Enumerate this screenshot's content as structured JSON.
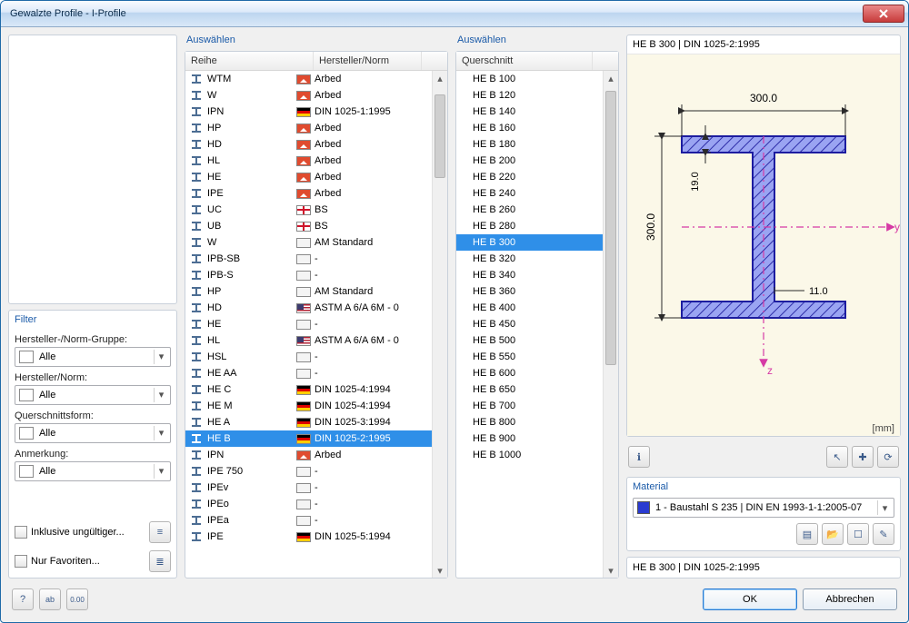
{
  "window": {
    "title": "Gewalzte Profile - I-Profile"
  },
  "filter": {
    "title": "Filter",
    "group_label": "Hersteller-/Norm-Gruppe:",
    "norm_label": "Hersteller/Norm:",
    "shape_label": "Querschnittsform:",
    "note_label": "Anmerkung:",
    "all": "Alle",
    "invalid": "Inklusive ungültiger...",
    "fav": "Nur Favoriten..."
  },
  "select_label": "Auswählen",
  "series_headers": {
    "c1": "Reihe",
    "c2": "Hersteller/Norm"
  },
  "series_scroll": {
    "thumb_top": 10,
    "thumb_height": 90
  },
  "series": [
    {
      "name": "IPE",
      "flag": "de",
      "norm": "DIN 1025-5:1994"
    },
    {
      "name": "IPEa",
      "flag": "blank",
      "norm": "-"
    },
    {
      "name": "IPEo",
      "flag": "blank",
      "norm": "-"
    },
    {
      "name": "IPEv",
      "flag": "blank",
      "norm": "-"
    },
    {
      "name": "IPE 750",
      "flag": "blank",
      "norm": "-"
    },
    {
      "name": "IPN",
      "flag": "red",
      "norm": "Arbed"
    },
    {
      "name": "HE B",
      "flag": "de",
      "norm": "DIN 1025-2:1995",
      "selected": true
    },
    {
      "name": "HE A",
      "flag": "de",
      "norm": "DIN 1025-3:1994"
    },
    {
      "name": "HE M",
      "flag": "de",
      "norm": "DIN 1025-4:1994"
    },
    {
      "name": "HE C",
      "flag": "de",
      "norm": "DIN 1025-4:1994"
    },
    {
      "name": "HE AA",
      "flag": "blank",
      "norm": "-"
    },
    {
      "name": "HSL",
      "flag": "blank",
      "norm": "-"
    },
    {
      "name": "HL",
      "flag": "us",
      "norm": "ASTM A 6/A 6M - 0"
    },
    {
      "name": "HE",
      "flag": "blank",
      "norm": "-"
    },
    {
      "name": "HD",
      "flag": "us",
      "norm": "ASTM A 6/A 6M - 0"
    },
    {
      "name": "HP",
      "flag": "blank",
      "norm": "AM Standard"
    },
    {
      "name": "IPB-S",
      "flag": "blank",
      "norm": "-"
    },
    {
      "name": "IPB-SB",
      "flag": "blank",
      "norm": "-"
    },
    {
      "name": "W",
      "flag": "blank",
      "norm": "AM Standard"
    },
    {
      "name": "UB",
      "flag": "uk",
      "norm": "BS"
    },
    {
      "name": "UC",
      "flag": "uk",
      "norm": "BS"
    },
    {
      "name": "IPE",
      "flag": "red",
      "norm": "Arbed"
    },
    {
      "name": "HE",
      "flag": "red",
      "norm": "Arbed"
    },
    {
      "name": "HL",
      "flag": "red",
      "norm": "Arbed"
    },
    {
      "name": "HD",
      "flag": "red",
      "norm": "Arbed"
    },
    {
      "name": "HP",
      "flag": "red",
      "norm": "Arbed"
    },
    {
      "name": "IPN",
      "flag": "de",
      "norm": "DIN 1025-1:1995"
    },
    {
      "name": "W",
      "flag": "red",
      "norm": "Arbed"
    },
    {
      "name": "WTM",
      "flag": "red",
      "norm": "Arbed"
    }
  ],
  "cs_header": "Querschnitt",
  "cs_scroll": {
    "thumb_top": 6,
    "thumb_height": 300
  },
  "cross_sections": [
    "HE B 100",
    "HE B 120",
    "HE B 140",
    "HE B 160",
    "HE B 180",
    "HE B 200",
    "HE B 220",
    "HE B 240",
    "HE B 260",
    "HE B 280",
    "HE B 300",
    "HE B 320",
    "HE B 340",
    "HE B 360",
    "HE B 400",
    "HE B 450",
    "HE B 500",
    "HE B 550",
    "HE B 600",
    "HE B 650",
    "HE B 700",
    "HE B 800",
    "HE B 900",
    "HE B 1000"
  ],
  "cs_selected": "HE B 300",
  "preview": {
    "title": "HE B 300 | DIN 1025-2:1995",
    "unit": "[mm]",
    "dims": {
      "width": "300.0",
      "height": "300.0",
      "tf": "19.0",
      "tw": "11.0"
    },
    "axes": {
      "y": "y",
      "z": "z"
    }
  },
  "material": {
    "title": "Material",
    "value": "1 - Baustahl S 235 | DIN EN 1993-1-1:2005-07"
  },
  "status": "HE B 300 | DIN 1025-2:1995",
  "buttons": {
    "ok": "OK",
    "cancel": "Abbrechen"
  },
  "icons": {
    "info": "ℹ",
    "pick": "↖",
    "axes": "✚",
    "rot": "⟳",
    "lib": "▤",
    "open": "📂",
    "new": "☐",
    "edit": "✎",
    "help": "?",
    "units": "ab",
    "decimals": "0.00",
    "filter1": "≡",
    "filter2": "≣"
  }
}
